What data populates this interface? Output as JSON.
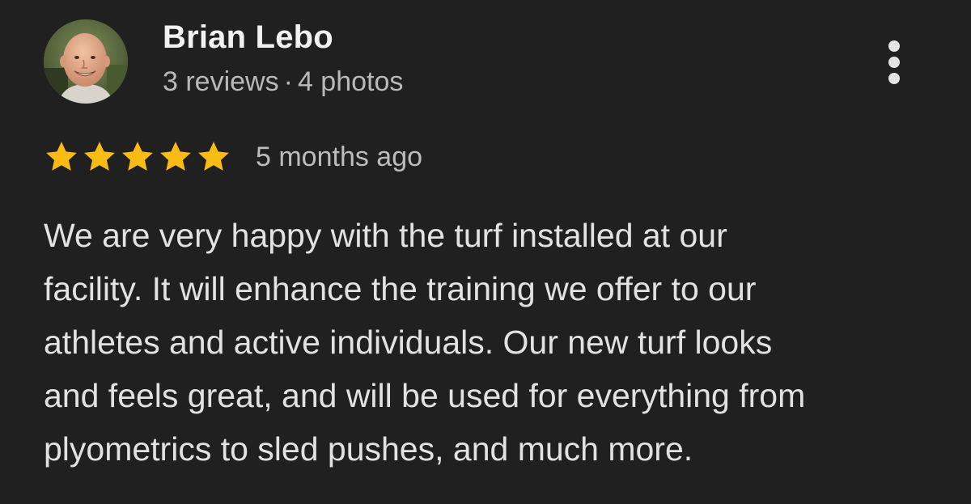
{
  "review": {
    "author": {
      "name": "Brian Lebo",
      "reviews": "3 reviews",
      "separator": "·",
      "photos": "4 photos",
      "avatar_icon": "user-photo"
    },
    "rating": {
      "stars": 5,
      "max_stars": 5,
      "star_color": "#F9BC15"
    },
    "timestamp": "5 months ago",
    "text_lines": [
      "We are very happy with the turf installed at our",
      "facility. It will enhance the training we offer to our",
      "athletes and active individuals. Our new turf looks",
      "and feels great, and will be used for everything from",
      "plyometrics to sled pushes, and much more."
    ],
    "menu_icon": "more-vertical-icon"
  },
  "theme": {
    "background": "#202020",
    "text_primary": "#F1F1F1",
    "text_secondary": "#B9B9B9"
  }
}
